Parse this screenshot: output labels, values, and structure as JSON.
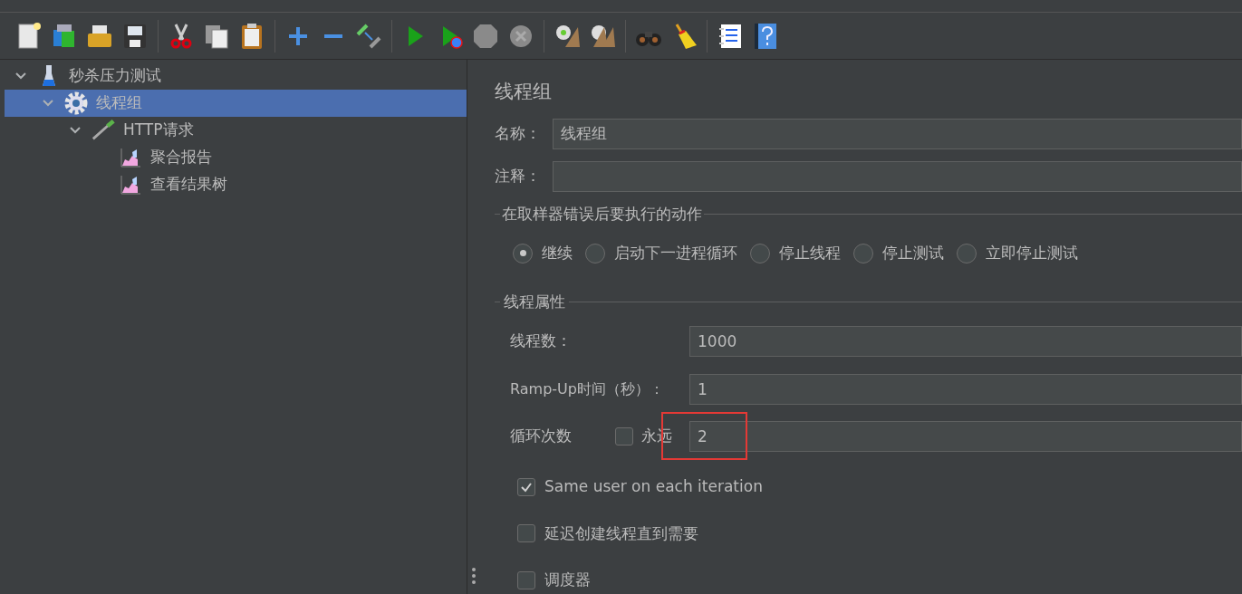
{
  "tree": [
    {
      "label": "秒杀压力测试",
      "kind": "test-plan",
      "expanded": true,
      "selected": false,
      "children": [
        {
          "label": "线程组",
          "kind": "thread-group",
          "expanded": true,
          "selected": true,
          "children": [
            {
              "label": "HTTP请求",
              "kind": "sampler",
              "expanded": true,
              "selected": false,
              "children": [
                {
                  "label": "聚合报告",
                  "kind": "listener",
                  "selected": false
                },
                {
                  "label": "查看结果树",
                  "kind": "listener",
                  "selected": false
                }
              ]
            }
          ]
        }
      ]
    }
  ],
  "panel": {
    "title": "线程组",
    "name_field": {
      "label": "名称：",
      "value": "线程组"
    },
    "comment_field": {
      "label": "注释："
    },
    "error_action": {
      "legend": "在取样器错误后要执行的动作",
      "options": [
        {
          "label": "继续",
          "selected": true
        },
        {
          "label": "启动下一进程循环",
          "selected": false
        },
        {
          "label": "停止线程",
          "selected": false
        },
        {
          "label": "停止测试",
          "selected": false
        },
        {
          "label": "立即停止测试",
          "selected": false
        }
      ]
    },
    "thread_properties": {
      "legend": "线程属性",
      "threads": {
        "label": "线程数：",
        "value": "1000"
      },
      "ramp_up": {
        "label": "Ramp-Up时间（秒）：",
        "value": "1"
      },
      "loop": {
        "label": "循环次数",
        "forever": {
          "label": "永远",
          "checked": false
        },
        "value": "2",
        "highlighted": true
      }
    },
    "options": [
      {
        "label": "Same user on each iteration",
        "checked": true
      },
      {
        "label": "延迟创建线程直到需要",
        "checked": false
      },
      {
        "label": "调度器",
        "checked": false
      }
    ]
  }
}
